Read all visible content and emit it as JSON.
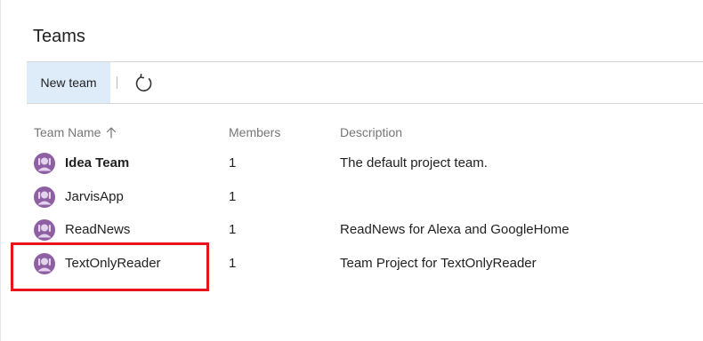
{
  "page": {
    "title": "Teams"
  },
  "toolbar": {
    "new_team_label": "New team",
    "refresh_icon": "refresh-icon"
  },
  "table": {
    "columns": {
      "team_name": "Team Name",
      "members": "Members",
      "description": "Description"
    },
    "sort": {
      "column": "team_name",
      "direction": "ascending",
      "icon": "arrow-up-icon"
    },
    "rows": [
      {
        "name": "Idea Team",
        "members": "1",
        "description": "The default project team.",
        "is_default": true
      },
      {
        "name": "JarvisApp",
        "members": "1",
        "description": "",
        "is_default": false
      },
      {
        "name": "ReadNews",
        "members": "1",
        "description": "ReadNews for Alexa and GoogleHome",
        "is_default": false
      },
      {
        "name": "TextOnlyReader",
        "members": "1",
        "description": "Team Project for TextOnlyReader",
        "is_default": false
      }
    ]
  },
  "highlight": {
    "row": "TextOnlyReader",
    "color": "#e8141c"
  },
  "colors": {
    "accent_button_bg": "#deecf9",
    "avatar_purple": "#8e5fa3",
    "header_text": "#767676"
  }
}
